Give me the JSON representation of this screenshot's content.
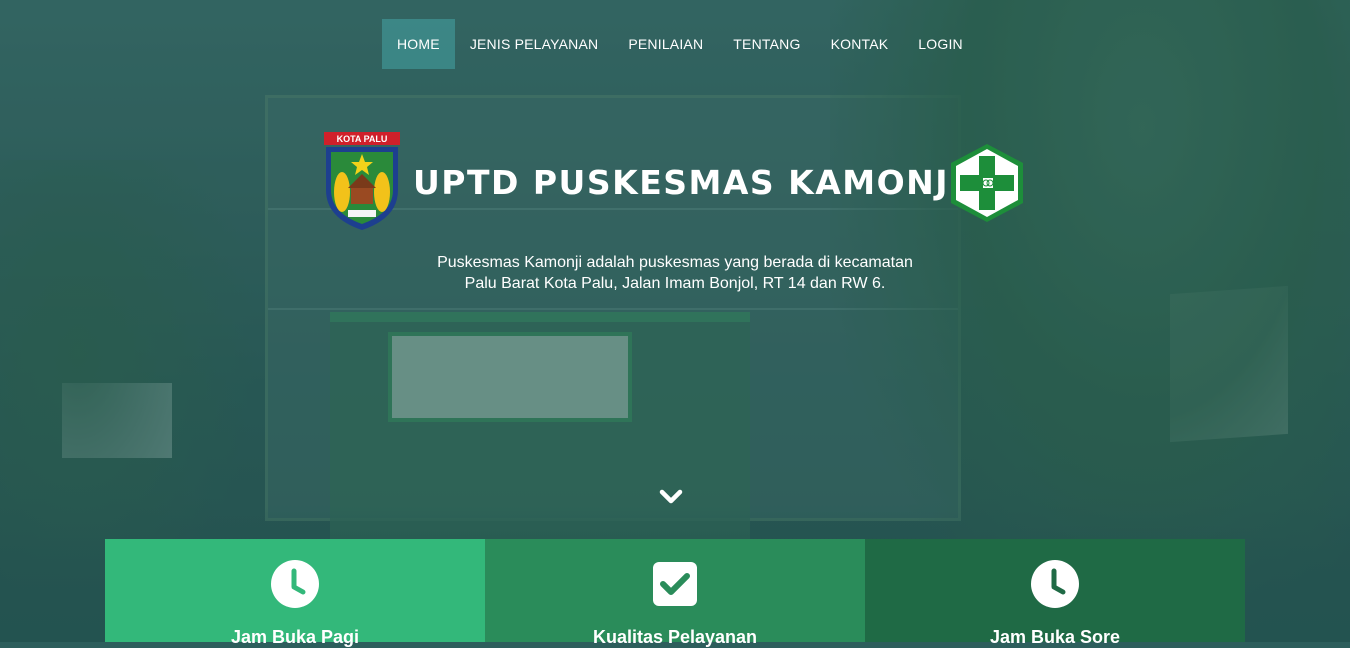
{
  "nav": {
    "items": [
      {
        "label": "HOME",
        "active": true
      },
      {
        "label": "JENIS PELAYANAN",
        "active": false
      },
      {
        "label": "PENILAIAN",
        "active": false
      },
      {
        "label": "TENTANG",
        "active": false
      },
      {
        "label": "KONTAK",
        "active": false
      },
      {
        "label": "LOGIN",
        "active": false
      }
    ]
  },
  "hero": {
    "logo_left_text": "KOTA PALU",
    "title": "UPTD PUSKESMAS KAMONJI",
    "description_line1": "Puskesmas Kamonji adalah puskesmas yang berada di kecamatan",
    "description_line2": "Palu Barat Kota Palu, Jalan Imam Bonjol, RT 14 dan RW 6.",
    "scroll_icon": "chevron-down-icon"
  },
  "features": [
    {
      "title": "Jam Buka Pagi",
      "icon": "clock-icon",
      "color": "#33b87a"
    },
    {
      "title": "Kualitas Pelayanan",
      "icon": "checkbox-icon",
      "color": "#2a8c5a"
    },
    {
      "title": "Jam Buka Sore",
      "icon": "clock-icon",
      "color": "#1f6a45"
    }
  ],
  "colors": {
    "nav_active": "#3d8a8a",
    "logo_green": "#1f9a3c"
  }
}
